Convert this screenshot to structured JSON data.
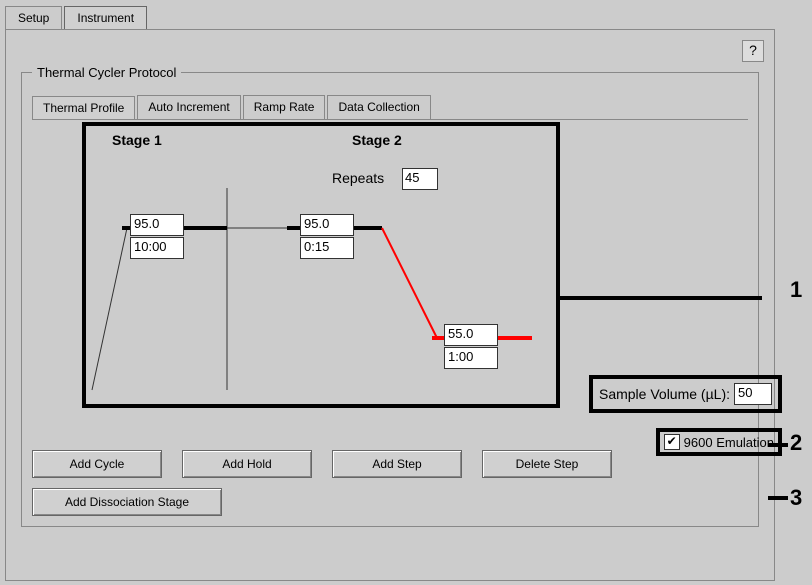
{
  "tabs": {
    "setup": "Setup",
    "instrument": "Instrument"
  },
  "help_icon": "?",
  "fieldset_title": "Thermal Cycler Protocol",
  "subtabs": {
    "thermal_profile": "Thermal Profile",
    "auto_increment": "Auto Increment",
    "ramp_rate": "Ramp Rate",
    "data_collection": "Data Collection"
  },
  "profile": {
    "stage1_label": "Stage 1",
    "stage2_label": "Stage 2",
    "repeats_label": "Repeats",
    "repeats_value": "45",
    "stage1_temp": "95.0",
    "stage1_time": "10:00",
    "stage2_step1_temp": "95.0",
    "stage2_step1_time": "0:15",
    "stage2_step2_temp": "55.0",
    "stage2_step2_time": "1:00"
  },
  "buttons": {
    "add_cycle": "Add Cycle",
    "add_hold": "Add Hold",
    "add_step": "Add Step",
    "delete_step": "Delete Step",
    "add_dissociation": "Add Dissociation Stage"
  },
  "sample_volume": {
    "label": "Sample Volume (µL):",
    "value": "50"
  },
  "emulation": {
    "label": "9600 Emulation",
    "checked": true
  },
  "callouts": {
    "c1": "1",
    "c2": "2",
    "c3": "3"
  }
}
